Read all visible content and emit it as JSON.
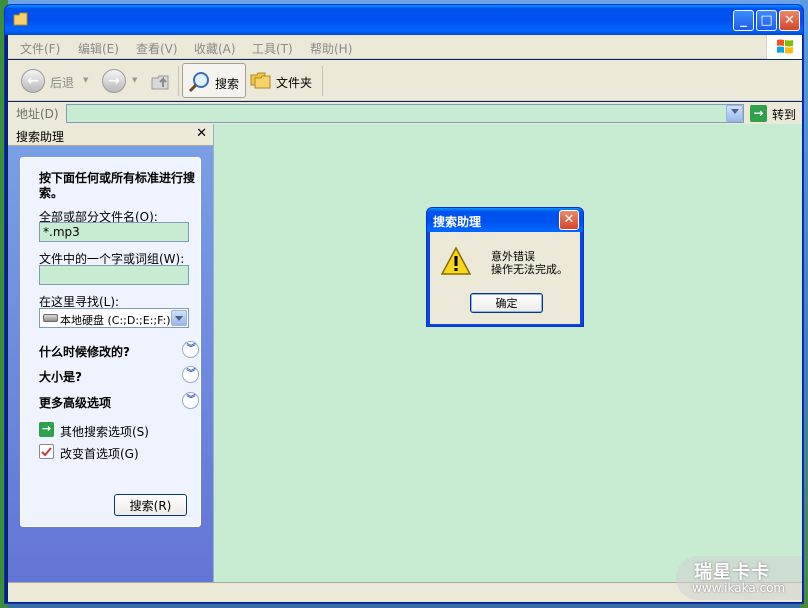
{
  "menubar": {
    "items": [
      "文件(F)",
      "编辑(E)",
      "查看(V)",
      "收藏(A)",
      "工具(T)",
      "帮助(H)"
    ]
  },
  "toolbar": {
    "back_label": "后退",
    "search_label": "搜索",
    "folders_label": "文件夹"
  },
  "address": {
    "label": "地址(D)",
    "value": "",
    "go_label": "转到"
  },
  "search_panel": {
    "title": "搜索助理",
    "heading": "按下面任何或所有标准进行搜索。",
    "filename_label": "全部或部分文件名(O):",
    "filename_value": "*.mp3",
    "phrase_label": "文件中的一个字或词组(W):",
    "phrase_value": "",
    "look_in_label": "在这里寻找(L):",
    "look_in_value": "本地硬盘 (C:;D:;E:;F:)",
    "sections": [
      "什么时候修改的?",
      "大小是?",
      "更多高级选项"
    ],
    "links": [
      "其他搜索选项(S)",
      "改变首选项(G)"
    ],
    "search_button": "搜索(R)"
  },
  "dialog": {
    "title": "搜索助理",
    "message_line1": "意外错误",
    "message_line2": "操作无法完成。",
    "ok_label": "确定"
  },
  "watermark": {
    "line1": "瑞星卡卡",
    "line2": "www.ikaka.com"
  },
  "colors": {
    "titlebar": "#0053ee",
    "results_bg": "#c7ecd1",
    "panel_bg": "#6f8fe0"
  }
}
